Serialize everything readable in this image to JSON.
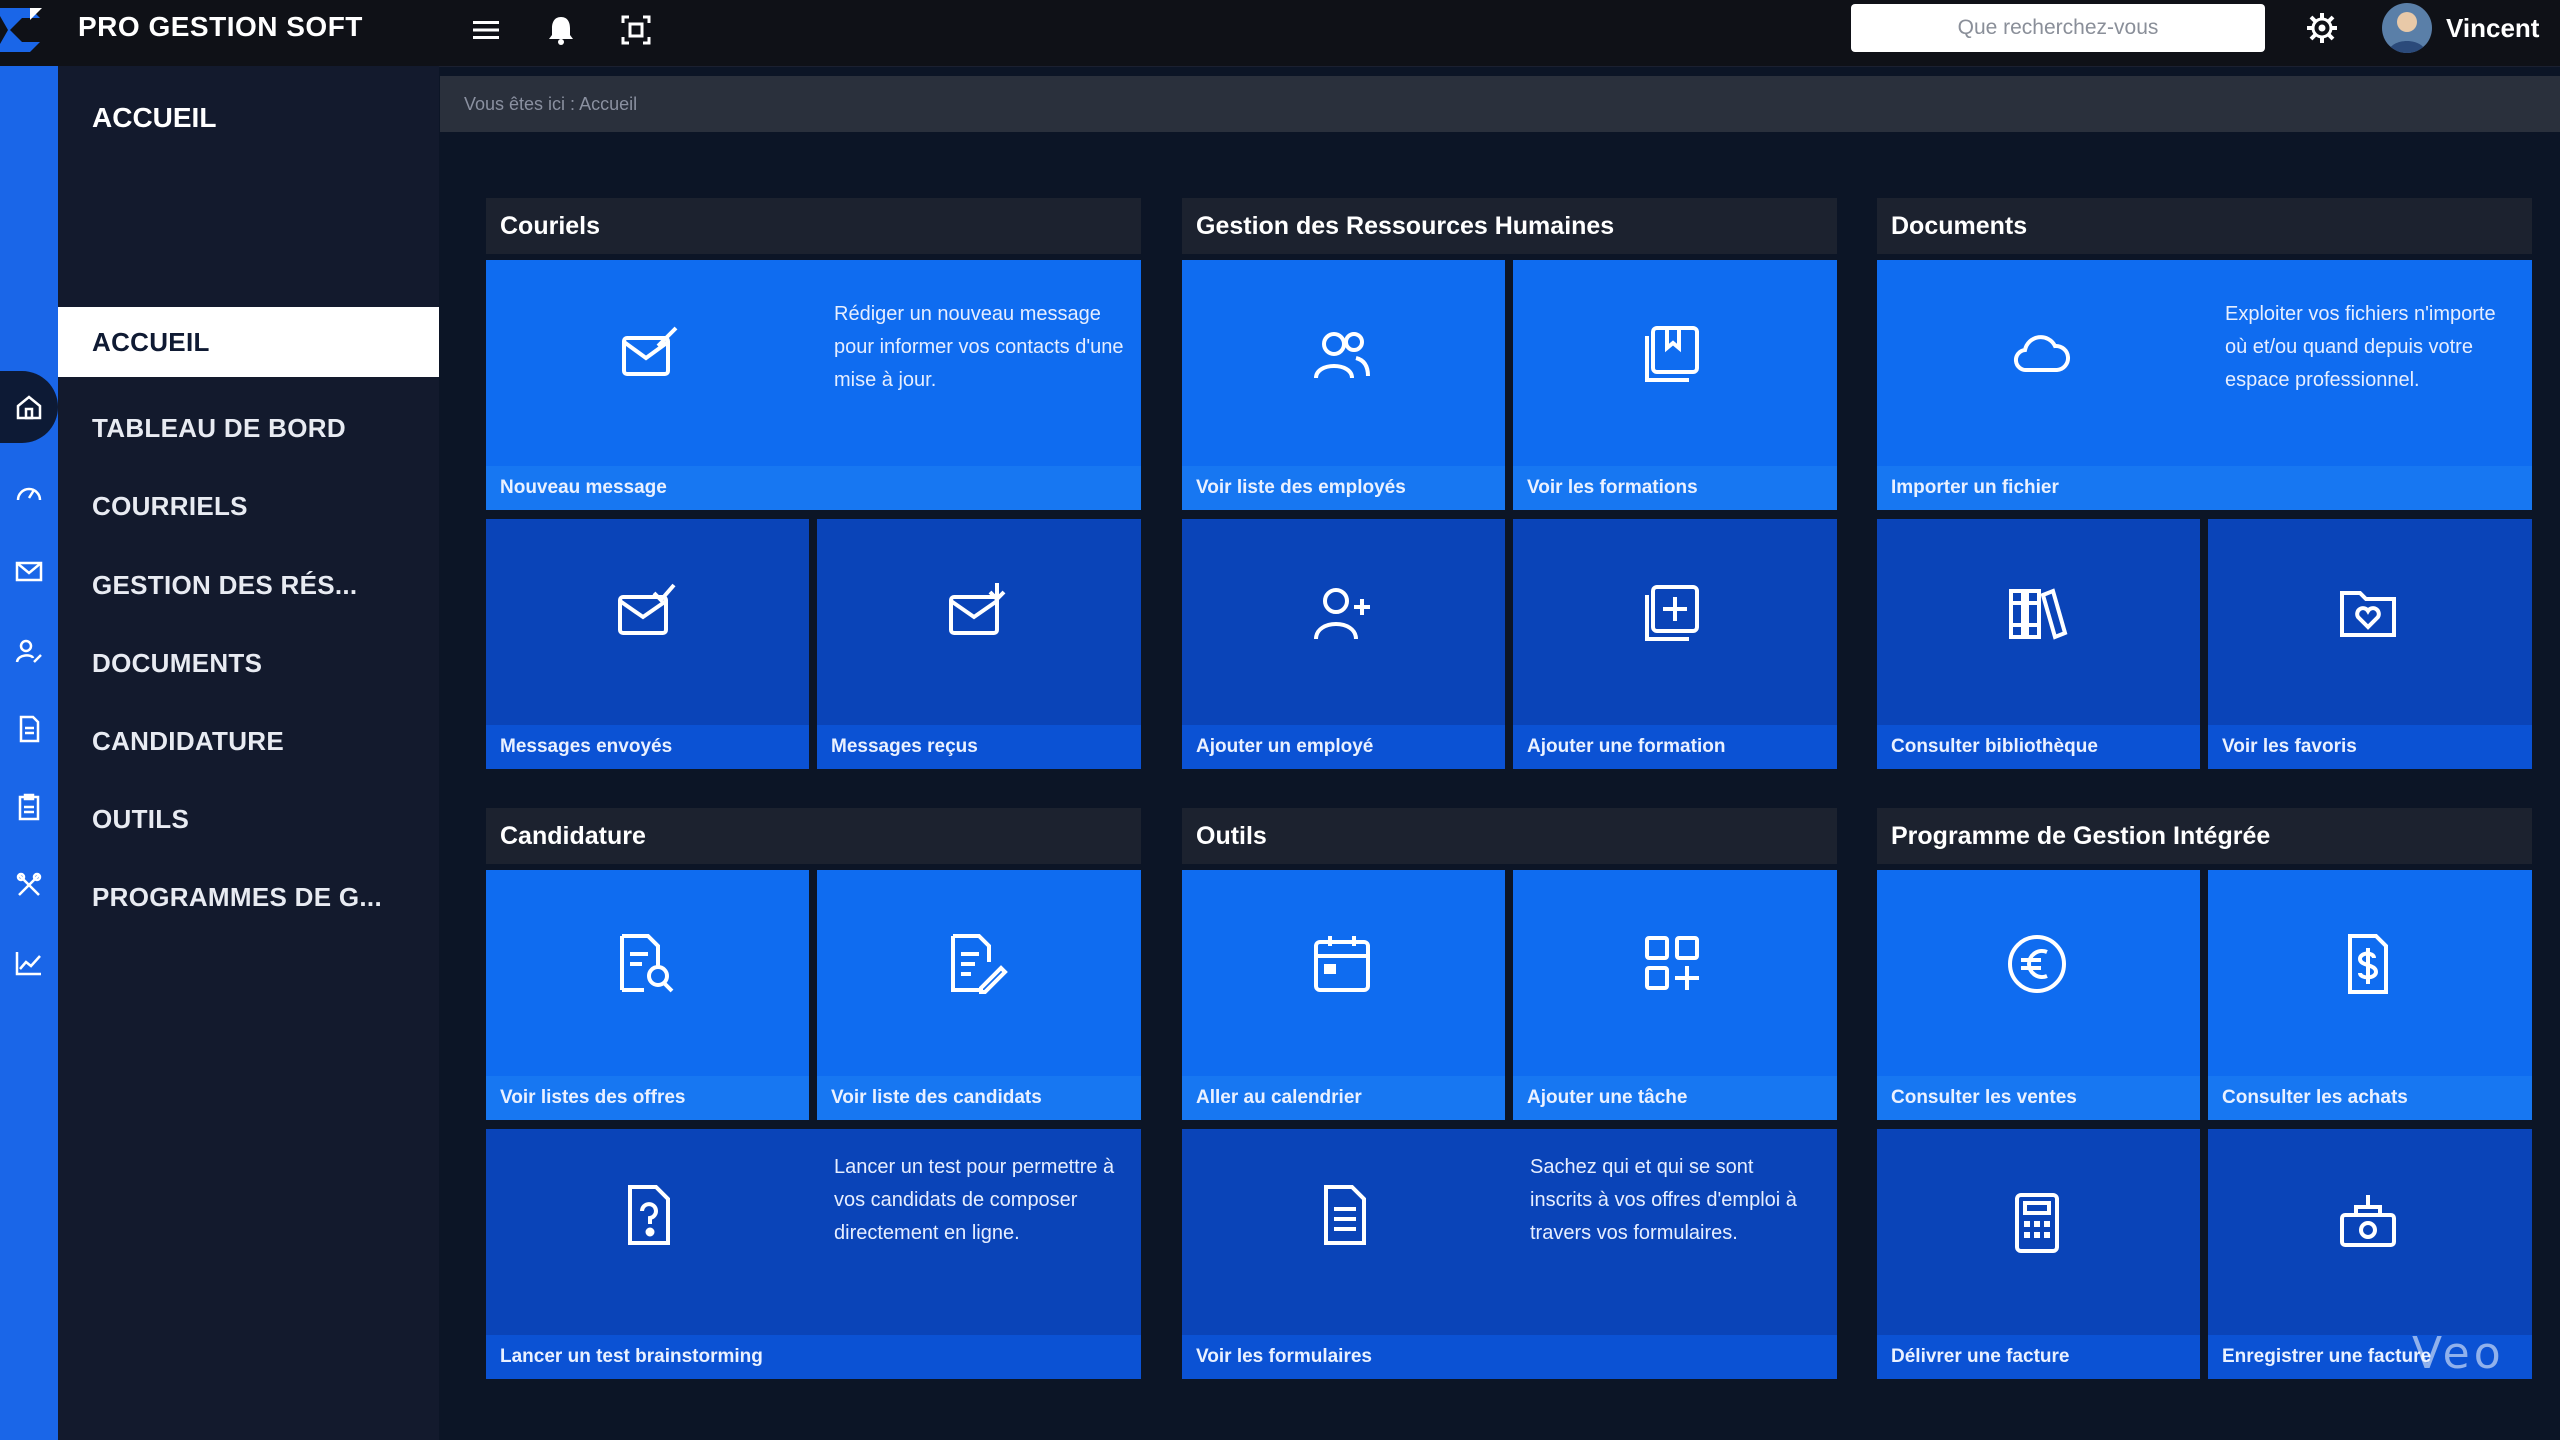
{
  "app": {
    "title": "PRO GESTION SOFT",
    "accent": "#1a66e8"
  },
  "header": {
    "search_placeholder": "Que recherchez-vous",
    "user_name": "Vincent",
    "icons": [
      "menu-icon",
      "bell-icon",
      "screen-capture-icon",
      "gear-icon"
    ]
  },
  "sidebar": {
    "title": "ACCUEIL",
    "items": [
      {
        "label": "ACCUEIL",
        "icon": "home-icon",
        "active": true
      },
      {
        "label": "TABLEAU DE BORD",
        "icon": "dashboard-icon"
      },
      {
        "label": "COURRIELS",
        "icon": "mail-icon"
      },
      {
        "label": "GESTION DES RÉS...",
        "icon": "user-edit-icon"
      },
      {
        "label": "DOCUMENTS",
        "icon": "document-icon"
      },
      {
        "label": "CANDIDATURE",
        "icon": "clipboard-icon"
      },
      {
        "label": "OUTILS",
        "icon": "tools-icon"
      },
      {
        "label": "PROGRAMMES DE G...",
        "icon": "chart-line-icon"
      }
    ]
  },
  "breadcrumb": "Vous êtes ici : Accueil",
  "sections": {
    "courriels": {
      "title": "Couriels",
      "tiles": [
        {
          "label": "Nouveau message",
          "desc": "Rédiger un nouveau message pour informer vos contacts d'une mise à jour.",
          "icon": "mail-edit-icon"
        },
        {
          "label": "Messages envoyés",
          "icon": "mail-check-icon"
        },
        {
          "label": "Messages reçus",
          "icon": "mail-download-icon"
        }
      ]
    },
    "rh": {
      "title": "Gestion des Ressources Humaines",
      "tiles": [
        {
          "label": "Voir liste des employés",
          "icon": "users-icon"
        },
        {
          "label": "Voir les formations",
          "icon": "book-icon"
        },
        {
          "label": "Ajouter un employé",
          "icon": "user-plus-icon"
        },
        {
          "label": "Ajouter une formation",
          "icon": "add-copy-icon"
        }
      ]
    },
    "documents": {
      "title": "Documents",
      "tiles": [
        {
          "label": "Importer un fichier",
          "desc": "Exploiter vos fichiers n'importe où et/ou quand depuis votre espace professionnel.",
          "icon": "cloud-icon"
        },
        {
          "label": "Consulter bibliothèque",
          "icon": "library-icon"
        },
        {
          "label": "Voir les favoris",
          "icon": "folder-heart-icon"
        }
      ]
    },
    "candidature": {
      "title": "Candidature",
      "tiles": [
        {
          "label": "Voir listes des offres",
          "icon": "doc-search-icon"
        },
        {
          "label": "Voir liste des candidats",
          "icon": "doc-edit-icon"
        },
        {
          "label": "Lancer un test brainstorming",
          "desc": "Lancer un test pour permettre à vos candidats de composer directement en ligne.",
          "icon": "doc-question-icon"
        }
      ]
    },
    "outils": {
      "title": "Outils",
      "tiles": [
        {
          "label": "Aller au calendrier",
          "icon": "calendar-icon"
        },
        {
          "label": "Ajouter une tâche",
          "icon": "grid-plus-icon"
        },
        {
          "label": "Voir les formulaires",
          "desc": "Sachez qui et qui se sont inscrits à vos offres d'emploi à travers vos formulaires.",
          "icon": "form-icon"
        }
      ]
    },
    "pgi": {
      "title": "Programme de Gestion Intégrée",
      "tiles": [
        {
          "label": "Consulter les ventes",
          "icon": "euro-icon"
        },
        {
          "label": "Consulter les achats",
          "icon": "invoice-dollar-icon"
        },
        {
          "label": "Délivrer une facture",
          "icon": "calculator-icon"
        },
        {
          "label": "Enregistrer une facture",
          "icon": "cash-register-icon"
        }
      ]
    }
  },
  "watermark": "Veo"
}
